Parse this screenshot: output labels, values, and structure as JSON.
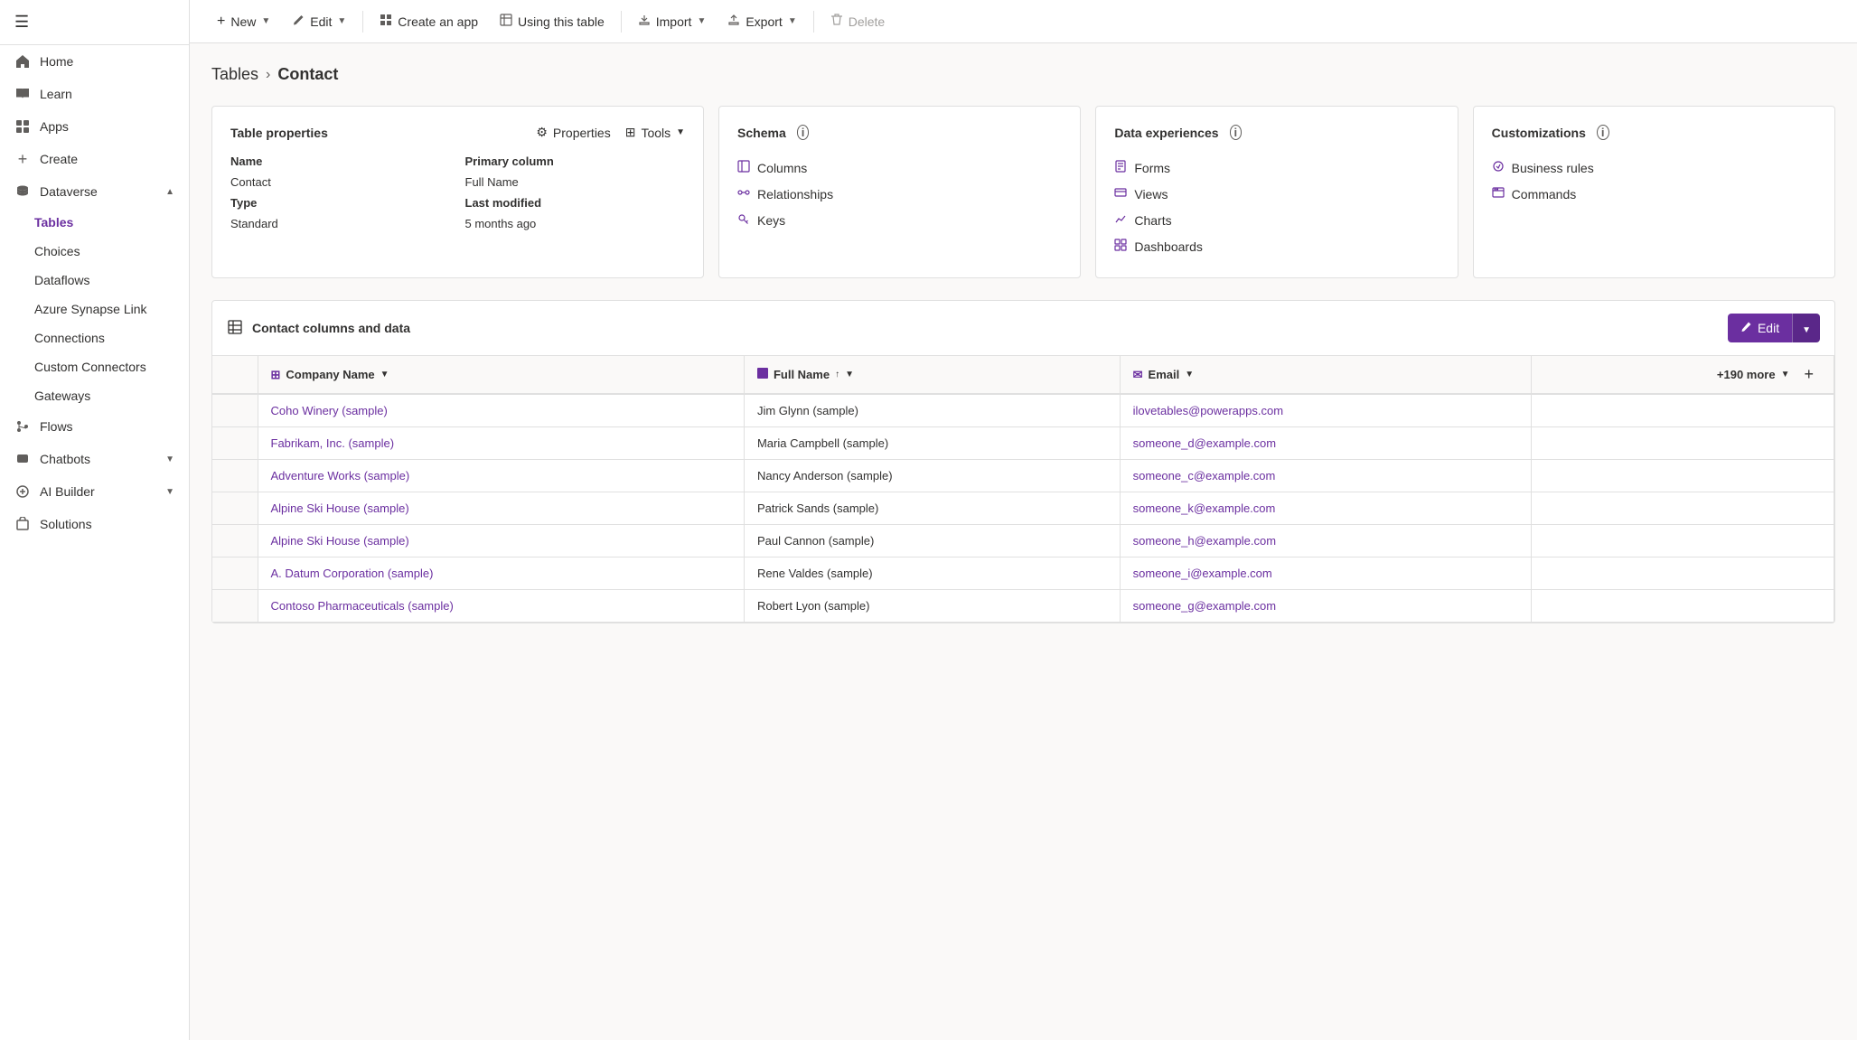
{
  "sidebar": {
    "hamburger_label": "☰",
    "items": [
      {
        "id": "home",
        "label": "Home",
        "icon": "🏠",
        "active": false
      },
      {
        "id": "learn",
        "label": "Learn",
        "icon": "📖",
        "active": false
      },
      {
        "id": "apps",
        "label": "Apps",
        "icon": "⊞",
        "active": false
      },
      {
        "id": "create",
        "label": "Create",
        "icon": "+",
        "active": false
      },
      {
        "id": "dataverse",
        "label": "Dataverse",
        "icon": "🗄",
        "active": false,
        "expanded": true
      }
    ],
    "dataverse_sub": [
      {
        "id": "tables",
        "label": "Tables",
        "active": true
      },
      {
        "id": "choices",
        "label": "Choices",
        "active": false
      },
      {
        "id": "dataflows",
        "label": "Dataflows",
        "active": false
      },
      {
        "id": "azure-synapse",
        "label": "Azure Synapse Link",
        "active": false
      },
      {
        "id": "connections",
        "label": "Connections",
        "active": false
      },
      {
        "id": "custom-connectors",
        "label": "Custom Connectors",
        "active": false
      },
      {
        "id": "gateways",
        "label": "Gateways",
        "active": false
      }
    ],
    "bottom_items": [
      {
        "id": "flows",
        "label": "Flows",
        "icon": "🔄"
      },
      {
        "id": "chatbots",
        "label": "Chatbots",
        "icon": "🤖",
        "has_chevron": true
      },
      {
        "id": "ai-builder",
        "label": "AI Builder",
        "icon": "🧠",
        "has_chevron": true
      },
      {
        "id": "solutions",
        "label": "Solutions",
        "icon": "📦"
      }
    ]
  },
  "toolbar": {
    "new_label": "New",
    "edit_label": "Edit",
    "create_app_label": "Create an app",
    "using_table_label": "Using this table",
    "import_label": "Import",
    "export_label": "Export",
    "delete_label": "Delete"
  },
  "breadcrumb": {
    "parent": "Tables",
    "current": "Contact"
  },
  "table_properties_card": {
    "title": "Table properties",
    "properties_btn": "Properties",
    "tools_btn": "Tools",
    "name_label": "Name",
    "name_value": "Contact",
    "primary_col_label": "Primary column",
    "primary_col_value": "Full Name",
    "type_label": "Type",
    "type_value": "Standard",
    "last_modified_label": "Last modified",
    "last_modified_value": "5 months ago"
  },
  "schema_card": {
    "title": "Schema",
    "items": [
      {
        "id": "columns",
        "label": "Columns"
      },
      {
        "id": "relationships",
        "label": "Relationships"
      },
      {
        "id": "keys",
        "label": "Keys"
      }
    ]
  },
  "data_experiences_card": {
    "title": "Data experiences",
    "items": [
      {
        "id": "forms",
        "label": "Forms"
      },
      {
        "id": "views",
        "label": "Views"
      },
      {
        "id": "charts",
        "label": "Charts"
      },
      {
        "id": "dashboards",
        "label": "Dashboards"
      }
    ]
  },
  "customizations_card": {
    "title": "Customizations",
    "items": [
      {
        "id": "business-rules",
        "label": "Business rules"
      },
      {
        "id": "commands",
        "label": "Commands"
      }
    ]
  },
  "data_section": {
    "title": "Contact columns and data",
    "edit_label": "Edit",
    "columns": [
      {
        "id": "checkbox",
        "label": ""
      },
      {
        "id": "company-name",
        "label": "Company Name",
        "icon": "⊞",
        "sortable": true
      },
      {
        "id": "full-name",
        "label": "Full Name",
        "icon": "⬛",
        "sortable": true,
        "sorted": true
      },
      {
        "id": "email",
        "label": "Email",
        "icon": "✉",
        "sortable": true
      },
      {
        "id": "more",
        "label": "+190 more"
      }
    ],
    "rows": [
      {
        "company": "Coho Winery (sample)",
        "full_name": "Jim Glynn (sample)",
        "email": "ilovetables@powerapps.com"
      },
      {
        "company": "Fabrikam, Inc. (sample)",
        "full_name": "Maria Campbell (sample)",
        "email": "someone_d@example.com"
      },
      {
        "company": "Adventure Works (sample)",
        "full_name": "Nancy Anderson (sample)",
        "email": "someone_c@example.com"
      },
      {
        "company": "Alpine Ski House (sample)",
        "full_name": "Patrick Sands (sample)",
        "email": "someone_k@example.com"
      },
      {
        "company": "Alpine Ski House (sample)",
        "full_name": "Paul Cannon (sample)",
        "email": "someone_h@example.com"
      },
      {
        "company": "A. Datum Corporation (sample)",
        "full_name": "Rene Valdes (sample)",
        "email": "someone_i@example.com"
      },
      {
        "company": "Contoso Pharmaceuticals (sample)",
        "full_name": "Robert Lyon (sample)",
        "email": "someone_g@example.com"
      }
    ],
    "more_cols_label": "+190 more"
  }
}
